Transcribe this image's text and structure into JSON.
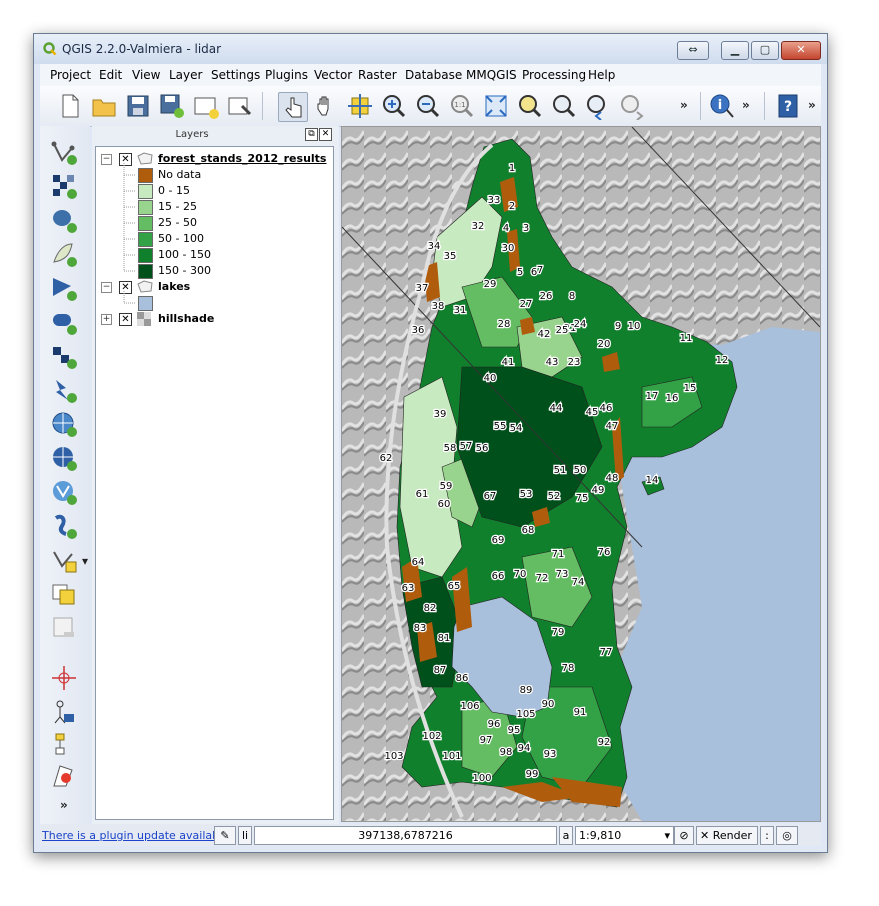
{
  "window": {
    "title": "QGIS 2.2.0-Valmiera - lidar",
    "app_icon": "qgis-logo-icon"
  },
  "menubar": {
    "items": [
      "Project",
      "Edit",
      "View",
      "Layer",
      "Settings",
      "Plugins",
      "Vector",
      "Raster",
      "Database",
      "MMQGIS",
      "Processing",
      "Help"
    ]
  },
  "toolbar": {
    "icons": [
      "new-project-icon",
      "open-project-icon",
      "save-project-icon",
      "save-as-icon",
      "new-print-composer-icon",
      "composer-manager-icon",
      "touch-zoom-icon",
      "pan-map-icon",
      "pan-to-selection-icon",
      "zoom-in-icon",
      "zoom-out-icon",
      "zoom-actual-size-icon",
      "zoom-full-icon",
      "zoom-to-selection-icon",
      "zoom-to-layer-icon",
      "zoom-last-icon",
      "zoom-next-icon",
      "identify-icon",
      "help-icon"
    ],
    "overflow": "»"
  },
  "left_toolbar": {
    "icons": [
      "add-vector-layer-icon",
      "add-raster-layer-icon",
      "add-postgis-layer-icon",
      "add-spatialite-layer-icon",
      "add-mssql-layer-icon",
      "add-oracle-layer-icon",
      "add-wms-layer-icon",
      "add-wcs-layer-icon",
      "add-wfs-layer-icon",
      "add-delimited-text-icon",
      "new-shapefile-icon",
      "new-spatialite-icon",
      "add-gpx-layer-icon",
      "add-virtual-layer-icon",
      "remove-layer-icon",
      "georeferencer-icon",
      "coordinate-capture-icon",
      "node-tool-icon",
      "heatmap-icon",
      "more-icon"
    ]
  },
  "layers_panel": {
    "title": "Layers",
    "layers": [
      {
        "name": "forest_stands_2012_results",
        "checked": true,
        "expanded": true,
        "legend": [
          {
            "label": "No data",
            "color": "#b05c0d"
          },
          {
            "label": "0 - 15",
            "color": "#c8eac0"
          },
          {
            "label": "15 - 25",
            "color": "#99d48e"
          },
          {
            "label": "25 - 50",
            "color": "#64bd62"
          },
          {
            "label": "50 - 100",
            "color": "#33a146"
          },
          {
            "label": "100 - 150",
            "color": "#11802d"
          },
          {
            "label": "150 - 300",
            "color": "#00501b"
          }
        ]
      },
      {
        "name": "lakes",
        "checked": true,
        "expanded": true,
        "legend_color": "#a8c0dc"
      },
      {
        "name": "hillshade",
        "checked": true,
        "expanded": false
      }
    ]
  },
  "map": {
    "lake_color": "#a8c0dc",
    "stand_labels": [
      "1",
      "2",
      "3",
      "4",
      "5",
      "6",
      "7",
      "8",
      "9",
      "10",
      "11",
      "12",
      "14",
      "15",
      "16",
      "17",
      "20",
      "21",
      "23",
      "24",
      "25",
      "26",
      "27",
      "28",
      "29",
      "30",
      "31",
      "32",
      "33",
      "34",
      "35",
      "36",
      "37",
      "38",
      "39",
      "40",
      "41",
      "42",
      "43",
      "44",
      "45",
      "46",
      "47",
      "48",
      "49",
      "50",
      "51",
      "52",
      "53",
      "54",
      "55",
      "56",
      "57",
      "58",
      "59",
      "60",
      "61",
      "62",
      "63",
      "64",
      "65",
      "66",
      "67",
      "68",
      "69",
      "70",
      "71",
      "72",
      "73",
      "74",
      "75",
      "76",
      "77",
      "78",
      "79",
      "81",
      "82",
      "83",
      "86",
      "87",
      "89",
      "90",
      "91",
      "92",
      "93",
      "94",
      "95",
      "96",
      "97",
      "98",
      "99",
      "100",
      "101",
      "102",
      "103",
      "105",
      "106"
    ]
  },
  "statusbar": {
    "plugin_notice": "There is a plugin update available",
    "coordinate": "397138,6787216",
    "scale_label": "a",
    "scale": "1:9,810",
    "render_label": "Render",
    "render_checked": true
  }
}
